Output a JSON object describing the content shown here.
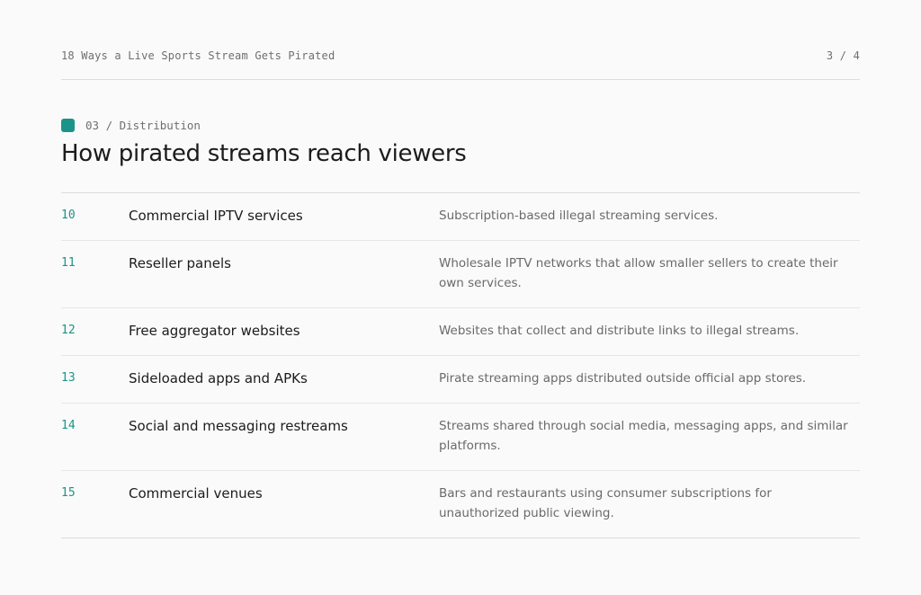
{
  "header": {
    "doc_title": "18 Ways a Live Sports Stream Gets Pirated",
    "page_indicator": "3 / 4"
  },
  "section": {
    "label": "03 / Distribution",
    "accent_color": "#1a9488",
    "heading": "How pirated streams reach viewers"
  },
  "rows": [
    {
      "num": "10",
      "name": "Commercial IPTV services",
      "desc": "Subscription-based illegal streaming services."
    },
    {
      "num": "11",
      "name": "Reseller panels",
      "desc": "Wholesale IPTV networks that allow smaller sellers to create their own services."
    },
    {
      "num": "12",
      "name": "Free aggregator websites",
      "desc": "Websites that collect and distribute links to illegal streams."
    },
    {
      "num": "13",
      "name": "Sideloaded apps and APKs",
      "desc": "Pirate streaming apps distributed outside official app stores."
    },
    {
      "num": "14",
      "name": "Social and messaging restreams",
      "desc": "Streams shared through social media, messaging apps, and similar platforms."
    },
    {
      "num": "15",
      "name": "Commercial venues",
      "desc": "Bars and restaurants using consumer subscriptions for unauthorized public viewing."
    }
  ]
}
